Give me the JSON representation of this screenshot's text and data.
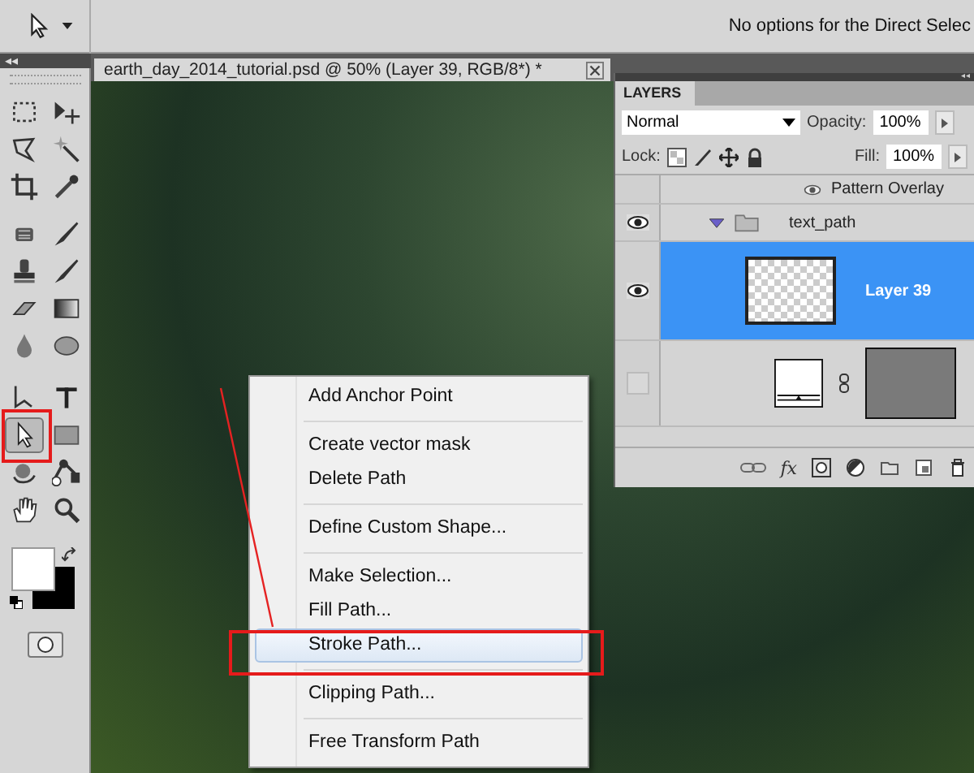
{
  "options_bar": {
    "message": "No options for the Direct Selec"
  },
  "toolbox": {
    "collapse_glyph": "◂◂",
    "tools": [
      {
        "selected": false
      },
      {
        "selected": false
      },
      {
        "selected": false
      },
      {
        "selected": false
      },
      {
        "selected": false
      },
      {
        "selected": false
      },
      {
        "selected": false
      },
      {
        "selected": false
      },
      {
        "selected": false
      },
      {
        "selected": false
      },
      {
        "selected": false
      },
      {
        "selected": false
      },
      {
        "selected": false
      },
      {
        "selected": false
      },
      {
        "selected": false
      },
      {
        "selected": false
      },
      {
        "selected": true
      },
      {
        "selected": false
      },
      {
        "selected": false
      },
      {
        "selected": false
      },
      {
        "selected": false
      },
      {
        "selected": false
      }
    ]
  },
  "document_tab": {
    "title": "earth_day_2014_tutorial.psd @ 50% (Layer 39, RGB/8*) *"
  },
  "layers_panel": {
    "collapse_glyph": "◂◂",
    "tab": "LAYERS",
    "blend_mode": "Normal",
    "opacity_label": "Opacity:",
    "opacity": "100%",
    "lock_label": "Lock:",
    "fill_label": "Fill:",
    "fill": "100%",
    "fx_label": "fx",
    "layers": [
      {
        "kind": "effect",
        "name": "Pattern Overlay",
        "visible": true,
        "selected": false
      },
      {
        "kind": "group",
        "name": "text_path",
        "visible": true,
        "expanded": true,
        "selected": false
      },
      {
        "kind": "layer",
        "name": "Layer 39",
        "visible": true,
        "selected": true
      },
      {
        "kind": "adjustment",
        "visible": false,
        "selected": false
      }
    ]
  },
  "context_menu": {
    "sections": [
      [
        {
          "label": "Add Anchor Point",
          "selected": false
        }
      ],
      [
        {
          "label": "Create vector mask",
          "selected": false
        },
        {
          "label": "Delete Path",
          "selected": false
        }
      ],
      [
        {
          "label": "Define Custom Shape...",
          "selected": false
        }
      ],
      [
        {
          "label": "Make Selection...",
          "selected": false
        },
        {
          "label": "Fill Path...",
          "selected": false
        },
        {
          "label": "Stroke Path...",
          "selected": true
        }
      ],
      [
        {
          "label": "Clipping Path...",
          "selected": false
        }
      ],
      [
        {
          "label": "Free Transform Path",
          "selected": false
        }
      ]
    ]
  },
  "callouts": [
    {
      "kind": "tool_frame"
    },
    {
      "kind": "menu_frame"
    },
    {
      "kind": "leader_line"
    }
  ]
}
